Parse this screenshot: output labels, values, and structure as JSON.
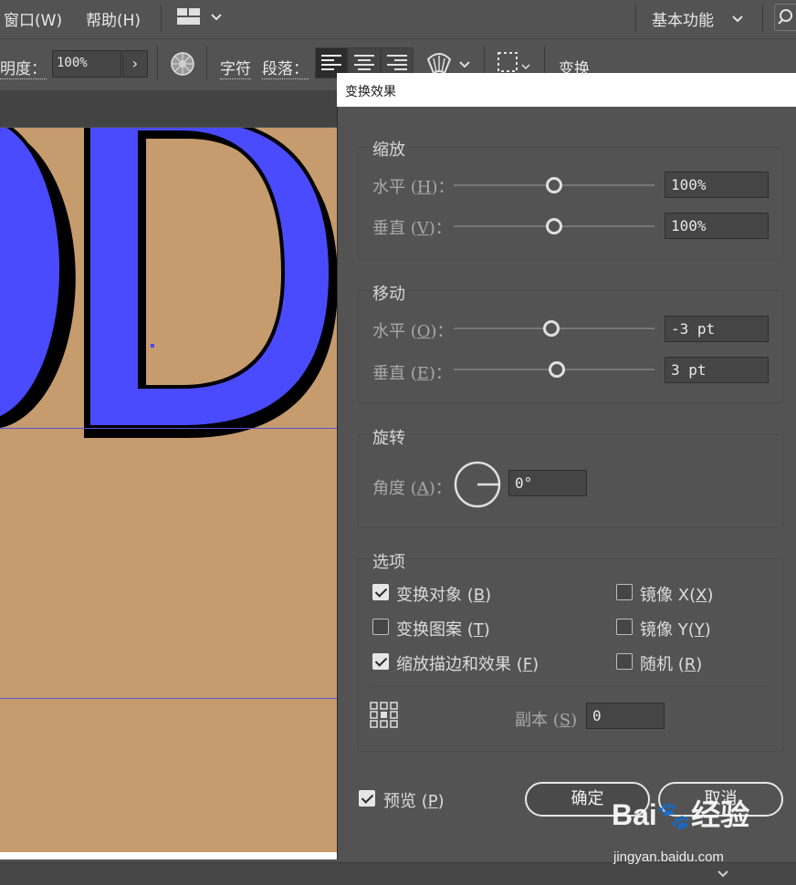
{
  "menubar": {
    "window": "窗口(W)",
    "help": "帮助(H)",
    "workspace": "基本功能"
  },
  "controlbar": {
    "opacity_label": "明度：",
    "opacity_value": "100%",
    "character": "字符",
    "paragraph": "段落：",
    "transform": "变换"
  },
  "dialog": {
    "title": "变换效果",
    "scale": {
      "title": "缩放",
      "horizontal_label": "水平",
      "horizontal_key": "H",
      "horizontal_value": "100%",
      "vertical_label": "垂直",
      "vertical_key": "V",
      "vertical_value": "100%"
    },
    "move": {
      "title": "移动",
      "horizontal_label": "水平",
      "horizontal_key": "O",
      "horizontal_value": "-3 pt",
      "vertical_label": "垂直",
      "vertical_key": "E",
      "vertical_value": "3 pt"
    },
    "rotate": {
      "title": "旋转",
      "angle_label": "角度",
      "angle_key": "A",
      "angle_value": "0°"
    },
    "options": {
      "title": "选项",
      "transform_objects": "变换对象",
      "transform_objects_key": "B",
      "transform_patterns": "变换图案",
      "transform_patterns_key": "T",
      "scale_strokes": "缩放描边和效果",
      "scale_strokes_key": "F",
      "reflect_x": "镜像 X",
      "reflect_x_key": "X",
      "reflect_y": "镜像 Y",
      "reflect_y_key": "Y",
      "random": "随机",
      "random_key": "R",
      "copies_label": "副本",
      "copies_key": "S",
      "copies_value": "0"
    },
    "preview": "预览",
    "preview_key": "P",
    "ok": "确定",
    "cancel": "取消"
  },
  "watermark": {
    "brand": "Bai",
    "brand_suffix": "经验",
    "url": "jingyan.baidu.com"
  },
  "colors": {
    "letter_fill": "#4a4aff",
    "canvas_bg": "#c69b6d",
    "guide": "#5a55d8"
  }
}
